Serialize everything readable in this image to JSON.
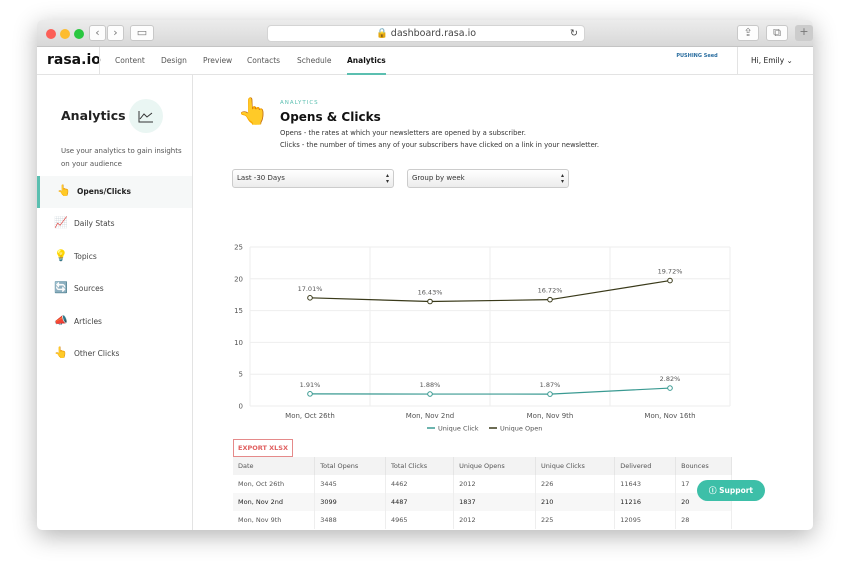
{
  "browser": {
    "url": "dashboard.rasa.io"
  },
  "nav": {
    "logo": "rasa.io",
    "items": [
      "Content",
      "Design",
      "Preview",
      "Contacts",
      "Schedule",
      "Analytics"
    ],
    "active": "Analytics",
    "brand_logo": "PUSHING Seed",
    "user": "Hi, Emily"
  },
  "sidebar": {
    "title": "Analytics",
    "description": "Use your analytics to gain insights on your audience",
    "items": [
      {
        "label": "Opens/Clicks",
        "icon": "pointing-hand-icon"
      },
      {
        "label": "Daily Stats",
        "icon": "chart-icon"
      },
      {
        "label": "Topics",
        "icon": "lightbulb-icon"
      },
      {
        "label": "Sources",
        "icon": "sources-icon"
      },
      {
        "label": "Articles",
        "icon": "megaphone-icon"
      },
      {
        "label": "Other Clicks",
        "icon": "pointing-hand-icon"
      }
    ]
  },
  "main": {
    "tag": "ANALYTICS",
    "title": "Opens & Clicks",
    "desc1": "Opens - the rates at which your newsletters are opened by a subscriber.",
    "desc2": "Clicks - the number of times any of your subscribers have clicked on a link in your newsletter.",
    "range_select": "Last -30 Days",
    "group_select": "Group by week",
    "export": "EXPORT XLSX",
    "support": "Support"
  },
  "chart_data": {
    "type": "line",
    "categories": [
      "Mon, Oct 26th",
      "Mon, Nov 2nd",
      "Mon, Nov 9th",
      "Mon, Nov 16th"
    ],
    "ylim": [
      0,
      25
    ],
    "yticks": [
      0,
      5,
      10,
      15,
      20,
      25
    ],
    "grid": true,
    "legend": "bottom",
    "series": [
      {
        "name": "Unique Click",
        "color": "#3a9a92",
        "values": [
          1.91,
          1.88,
          1.87,
          2.82
        ],
        "labels": [
          "1.91%",
          "1.88%",
          "1.87%",
          "2.82%"
        ]
      },
      {
        "name": "Unique Open",
        "color": "#3a3a1a",
        "values": [
          17.01,
          16.43,
          16.72,
          19.72
        ],
        "labels": [
          "17.01%",
          "16.43%",
          "16.72%",
          "19.72%"
        ]
      }
    ]
  },
  "table": {
    "headers": [
      "Date",
      "Total Opens",
      "Total Clicks",
      "Unique Opens",
      "Unique Clicks",
      "Delivered",
      "Bounces"
    ],
    "rows": [
      [
        "Mon, Oct 26th",
        "3445",
        "4462",
        "2012",
        "226",
        "11643",
        "17"
      ],
      [
        "Mon, Nov 2nd",
        "3099",
        "4487",
        "1837",
        "210",
        "11216",
        "20"
      ],
      [
        "Mon, Nov 9th",
        "3488",
        "4965",
        "2012",
        "225",
        "12095",
        "28"
      ]
    ]
  }
}
